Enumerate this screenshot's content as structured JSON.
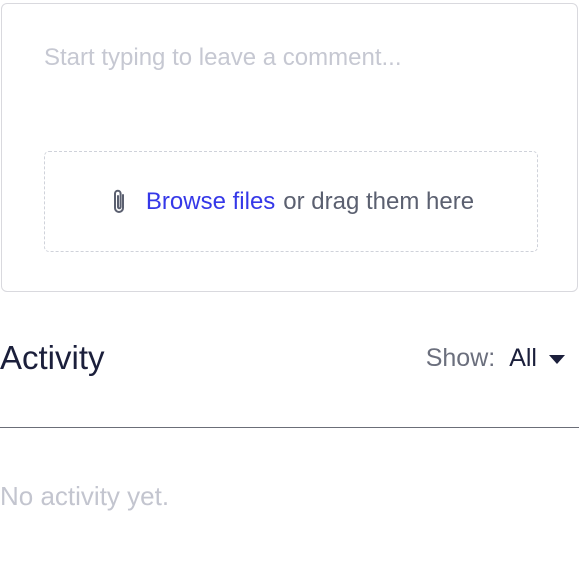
{
  "comment": {
    "placeholder": "Start typing to leave a comment...",
    "attach_icon": "paperclip-icon",
    "browse_label": "Browse files",
    "drag_text": "or drag them here"
  },
  "activity": {
    "title": "Activity",
    "show_label": "Show:",
    "show_value": "All",
    "empty_text": "No activity yet."
  },
  "colors": {
    "link": "#3538e8",
    "text": "#1b1f3b",
    "muted": "#6b6f7d",
    "placeholder": "#c6c8d2"
  }
}
